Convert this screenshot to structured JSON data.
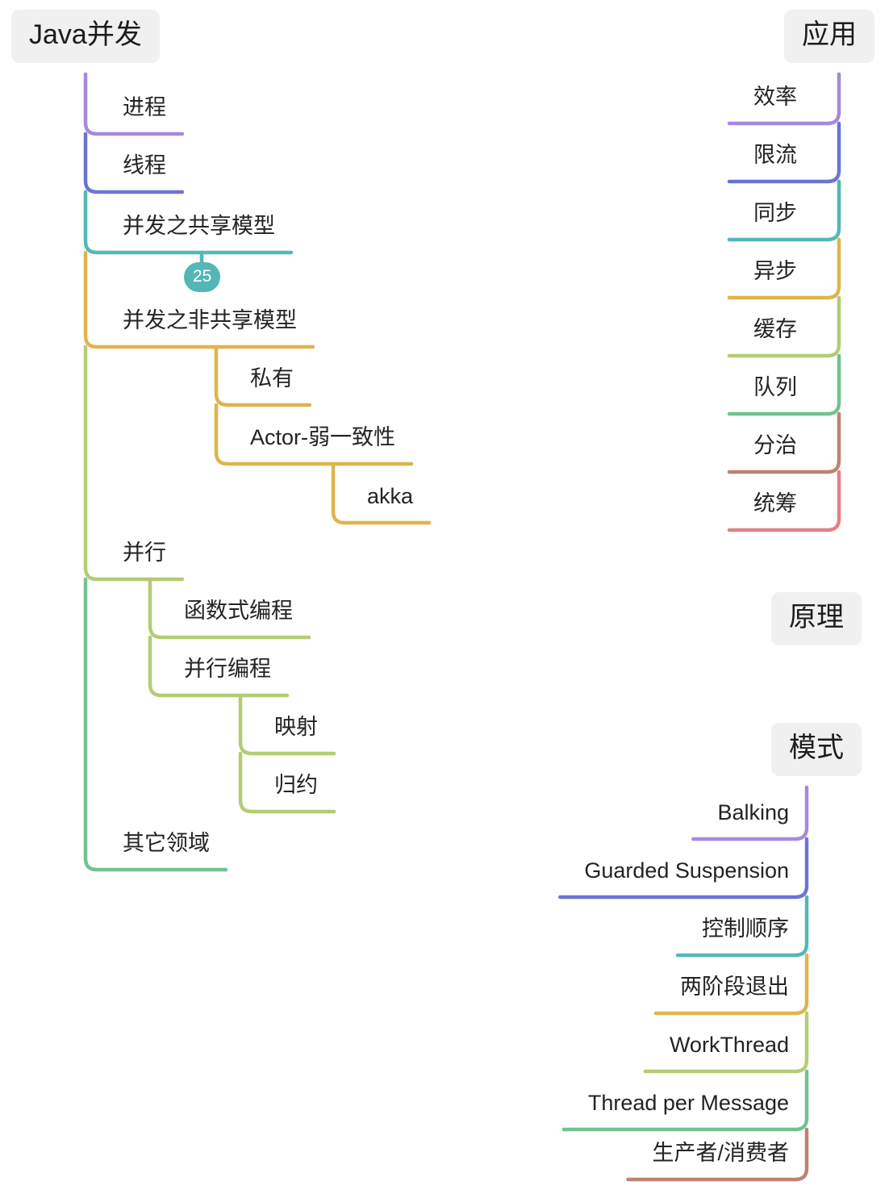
{
  "diagram": {
    "title": "Java并发",
    "type": "mindmap",
    "background": "#ffffff",
    "node_box_color": "#f0f0f0",
    "text_color": "#232323",
    "palette": [
      "#a689de",
      "#6d73d4",
      "#53b7b7",
      "#e0b44c",
      "#b4cc74",
      "#71c292",
      "#bf8273",
      "#e0818a"
    ]
  },
  "roots": [
    {
      "id": "java-concurrency",
      "label": "Java并发",
      "side": "left",
      "children": [
        {
          "label": "进程",
          "color": "#a689de"
        },
        {
          "label": "线程",
          "color": "#6d73d4"
        },
        {
          "label": "并发之共享模型",
          "color": "#53b7b7",
          "badge": "25"
        },
        {
          "label": "并发之非共享模型",
          "color": "#e0b44c",
          "children": [
            {
              "label": "私有",
              "color": "#e0b44c"
            },
            {
              "label": "Actor-弱一致性",
              "color": "#e0b44c",
              "children": [
                {
                  "label": "akka",
                  "color": "#e0b44c"
                }
              ]
            }
          ]
        },
        {
          "label": "并行",
          "color": "#b4cc74",
          "children": [
            {
              "label": "函数式编程",
              "color": "#b4cc74"
            },
            {
              "label": "并行编程",
              "color": "#b4cc74",
              "children": [
                {
                  "label": "映射",
                  "color": "#b4cc74"
                },
                {
                  "label": "归约",
                  "color": "#b4cc74"
                }
              ]
            }
          ]
        },
        {
          "label": "其它领域",
          "color": "#71c292"
        }
      ]
    },
    {
      "id": "application",
      "label": "应用",
      "side": "right",
      "children": [
        {
          "label": "效率",
          "color": "#a689de"
        },
        {
          "label": "限流",
          "color": "#6d73d4"
        },
        {
          "label": "同步",
          "color": "#53b7b7"
        },
        {
          "label": "异步",
          "color": "#e0b44c"
        },
        {
          "label": "缓存",
          "color": "#b4cc74"
        },
        {
          "label": "队列",
          "color": "#71c292"
        },
        {
          "label": "分治",
          "color": "#bf8273"
        },
        {
          "label": "统筹",
          "color": "#e0818a"
        }
      ]
    },
    {
      "id": "principles",
      "label": "原理",
      "side": "right",
      "children": []
    },
    {
      "id": "patterns",
      "label": "模式",
      "side": "right",
      "children": [
        {
          "label": "Balking",
          "color": "#a689de"
        },
        {
          "label": "Guarded Suspension",
          "color": "#6d73d4"
        },
        {
          "label": "控制顺序",
          "color": "#53b7b7"
        },
        {
          "label": "两阶段退出",
          "color": "#e0b44c"
        },
        {
          "label": "WorkThread",
          "color": "#b4cc74"
        },
        {
          "label": "Thread per Message",
          "color": "#71c292"
        },
        {
          "label": "生产者/消费者",
          "color": "#bf8273"
        }
      ]
    }
  ]
}
